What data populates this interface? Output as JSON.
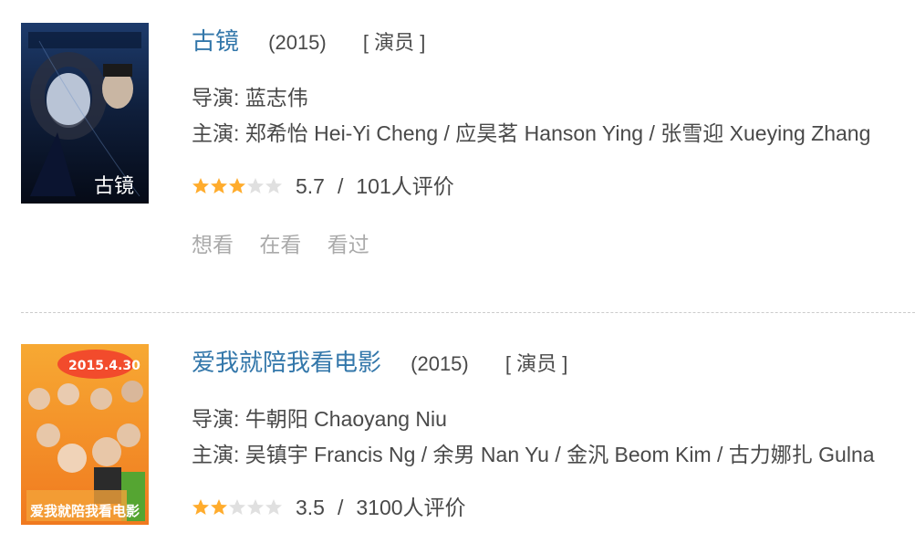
{
  "movies": [
    {
      "title": "古镜",
      "year": "(2015)",
      "role": "[ 演员 ]",
      "director_line": "导演: 蓝志伟",
      "cast_line": "主演: 郑希怡 Hei-Yi Cheng / 应昊茗 Hanson Ying / 张雪迎 Xueying Zhang",
      "stars": 3,
      "score": "5.7",
      "rating_count": "101人评价",
      "actions": [
        "想看",
        "在看",
        "看过"
      ],
      "poster_text": "古镜"
    },
    {
      "title": "爱我就陪我看电影",
      "year": "(2015)",
      "role": "[ 演员 ]",
      "director_line": "导演: 牛朝阳 Chaoyang Niu",
      "cast_line": "主演: 吴镇宇 Francis Ng / 余男 Nan Yu / 金汎 Beom Kim / 古力娜扎 Gulna",
      "stars": 2,
      "score": "3.5",
      "rating_count": "3100人评价",
      "poster_text": "2015.4.30",
      "poster_subtitle": "爱我就陪我看电影"
    }
  ],
  "separator": "/",
  "colors": {
    "title": "#3377aa",
    "star_on": "#ffac2d",
    "star_off": "#e0e0e0",
    "muted": "#aaaaaa"
  }
}
